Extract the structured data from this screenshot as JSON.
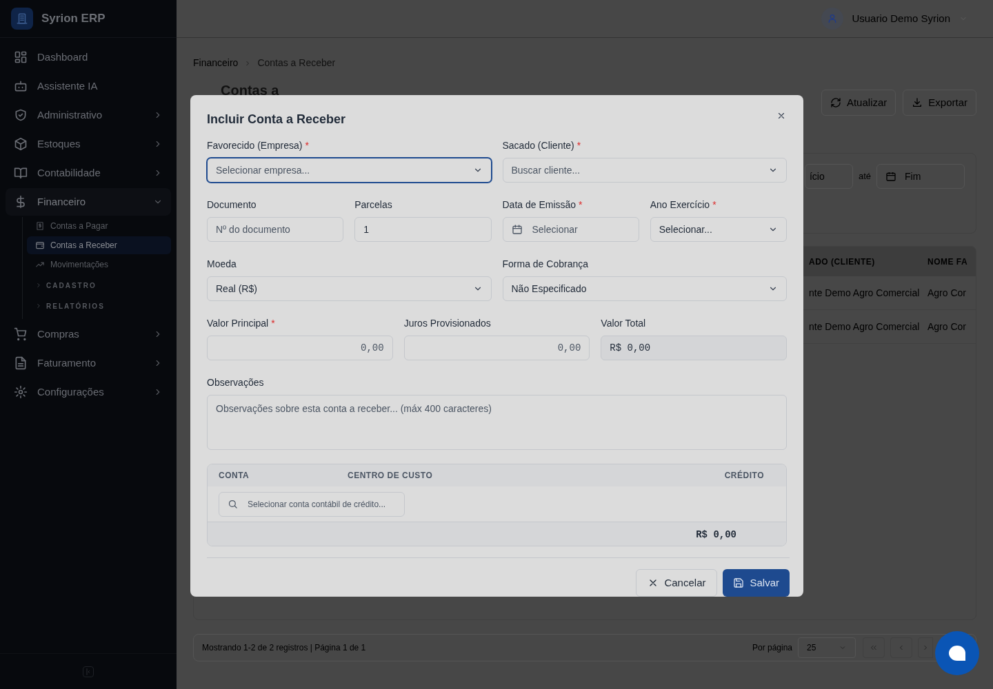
{
  "brand": {
    "name": "Syrion ERP"
  },
  "sidebar": {
    "items": [
      {
        "label": "Dashboard",
        "selected": false
      },
      {
        "label": "Assistente IA",
        "selected": false
      },
      {
        "label": "Administrativo",
        "expanded": false,
        "selected": false
      },
      {
        "label": "Estoques",
        "expanded": false,
        "selected": false
      },
      {
        "label": "Contabilidade",
        "expanded": false,
        "selected": false
      },
      {
        "label": "Financeiro",
        "expanded": true,
        "selected": true,
        "children": [
          {
            "kind": "link",
            "label": "Contas a Pagar",
            "selected": false
          },
          {
            "kind": "link",
            "label": "Contas a Receber",
            "selected": true
          },
          {
            "kind": "link",
            "label": "Movimentações",
            "selected": false
          },
          {
            "kind": "section",
            "label": "CADASTRO",
            "expanded": false
          },
          {
            "kind": "section",
            "label": "RELATÓRIOS",
            "expanded": false
          }
        ]
      },
      {
        "label": "Compras",
        "expanded": false,
        "selected": false
      },
      {
        "label": "Faturamento",
        "expanded": false,
        "selected": false
      },
      {
        "label": "Configurações",
        "expanded": false,
        "selected": false
      }
    ]
  },
  "user": {
    "name": "Usuario Demo Syrion"
  },
  "breadcrumb": [
    "Financeiro",
    "Contas a Receber"
  ],
  "page_title": "Contas a",
  "toolbar": [
    "Atualizar",
    "Exportar"
  ],
  "filters": {
    "start_fragment": "ício",
    "separator": "até",
    "end_placeholder": "Fim"
  },
  "table": {
    "columns": [
      "ADO (CLIENTE)",
      "NOME FA"
    ],
    "rows": [
      [
        "nte Demo Agro Comercial",
        "Agro Cor"
      ],
      [
        "nte Demo Agro Comercial",
        "Agro Cor"
      ]
    ]
  },
  "pagination": {
    "summary": "Mostrando 1-2 de 2 registros | Página 1 de 1",
    "per_page_label": "Por página",
    "per_page": "25"
  },
  "modal": {
    "title": "Incluir Conta a Receber",
    "groups": [
      {
        "fields": [
          {
            "label": "Favorecido (Empresa)",
            "required_mark": "*",
            "kind": "select",
            "placeholder": "Selecionar empresa...",
            "focused": true
          },
          {
            "label": "Sacado (Cliente)",
            "required_mark": "*",
            "kind": "select",
            "placeholder": "Buscar cliente...",
            "focused": false
          }
        ]
      },
      {
        "fields": [
          {
            "label": "Documento",
            "kind": "input",
            "placeholder": "Nº do documento",
            "focused": false
          },
          {
            "label": "Parcelas",
            "kind": "input",
            "value": "1",
            "focused": false
          },
          {
            "label": "Data de Emissão",
            "required_mark": "*",
            "kind": "date",
            "placeholder": "Selecionar",
            "focused": false
          },
          {
            "label": "Ano Exercício",
            "required_mark": "*",
            "kind": "select",
            "value": "Selecionar...",
            "focused": false
          }
        ]
      },
      {
        "fields": [
          {
            "label": "Moeda",
            "kind": "select",
            "value": "Real (R$)",
            "focused": false
          },
          {
            "label": "Forma de Cobrança",
            "kind": "select",
            "value": "Não Especificado",
            "focused": false
          }
        ]
      },
      {
        "fields": [
          {
            "label": "Valor Principal",
            "required_mark": "*",
            "kind": "money",
            "value": "0,00",
            "focused": false
          },
          {
            "label": "Juros Provisionados",
            "kind": "money",
            "value": "0,00",
            "focused": false
          },
          {
            "label": "Valor Total",
            "kind": "readonly",
            "value": "R$ 0,00",
            "focused": false
          }
        ]
      }
    ],
    "notes": {
      "label": "Observações",
      "placeholder": "Observações sobre esta conta a receber... (máx 400 caracteres)"
    },
    "entries": {
      "columns": [
        "CONTA",
        "CENTRO DE CUSTO",
        "CRÉDITO"
      ],
      "search_placeholder": "Selecionar conta contábil de crédito...",
      "total": "R$ 0,00"
    },
    "buttons": [
      {
        "kind": "secondary",
        "label": "Cancelar"
      },
      {
        "kind": "primary",
        "label": "Salvar"
      }
    ]
  }
}
